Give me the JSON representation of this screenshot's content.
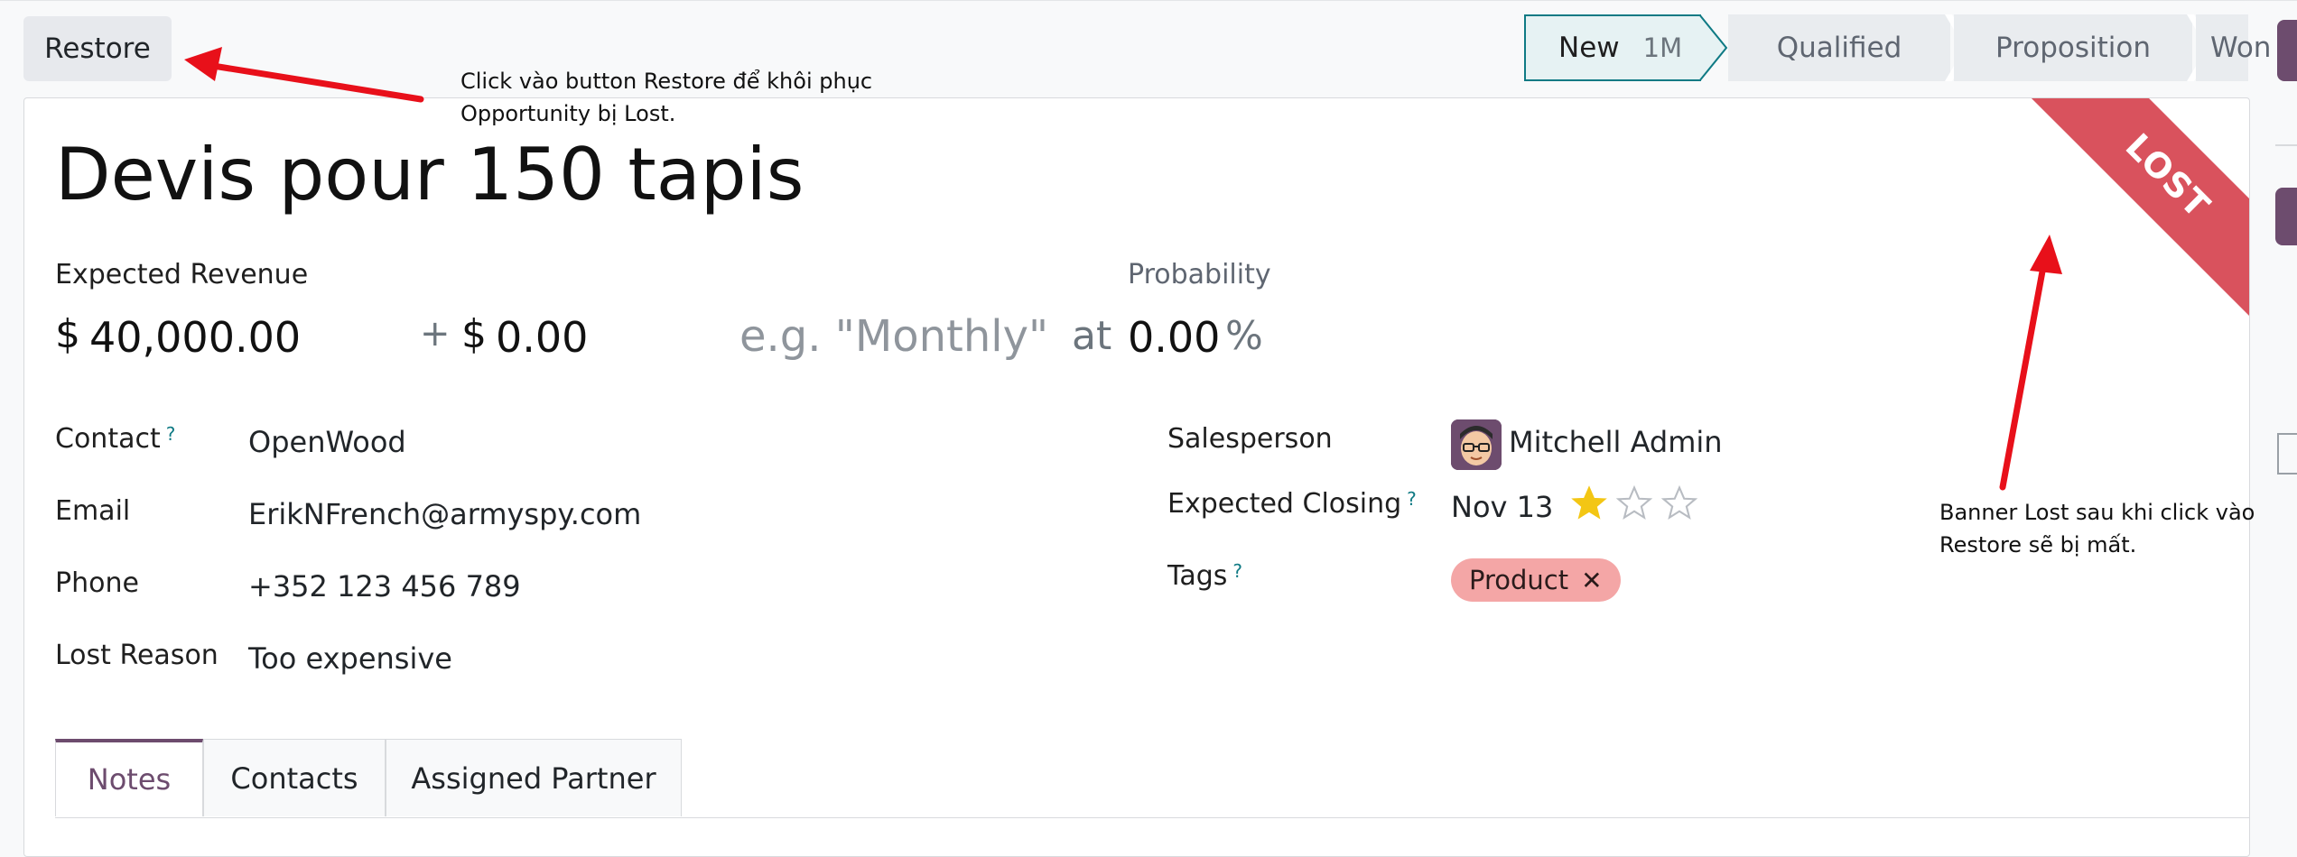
{
  "toolbar": {
    "restore_label": "Restore"
  },
  "statusbar": {
    "stages": [
      {
        "label": "New",
        "count": "1M",
        "active": true
      },
      {
        "label": "Qualified"
      },
      {
        "label": "Proposition"
      },
      {
        "label": "Won"
      }
    ]
  },
  "annotations": {
    "restore_note": "Click vào button Restore để khôi phục\nOpportunity bị Lost.",
    "banner_note": "Banner Lost sau khi click vào\nRestore sẽ bị mất."
  },
  "ribbon": {
    "text": "LOST",
    "color": "#d9525d"
  },
  "record": {
    "title": "Devis pour 150 tapis",
    "expected_revenue_label": "Expected Revenue",
    "currency": "$",
    "expected_revenue": "40,000.00",
    "plus": "+",
    "recurring_revenue": "0.00",
    "recurring_plan_placeholder": "e.g. \"Monthly\"",
    "at": "at",
    "probability_label": "Probability",
    "probability": "0.00",
    "percent": "%"
  },
  "left_fields": {
    "contact_label": "Contact",
    "contact": "OpenWood",
    "email_label": "Email",
    "email": "ErikNFrench@armyspy.com",
    "phone_label": "Phone",
    "phone": "+352 123 456 789",
    "lost_reason_label": "Lost Reason",
    "lost_reason": "Too expensive"
  },
  "right_fields": {
    "salesperson_label": "Salesperson",
    "salesperson": "Mitchell Admin",
    "expected_closing_label": "Expected Closing",
    "expected_closing": "Nov 13",
    "priority": 1,
    "priority_max": 3,
    "tags_label": "Tags",
    "tag": "Product"
  },
  "help_mark": "?",
  "tabs": [
    {
      "label": "Notes",
      "active": true
    },
    {
      "label": "Contacts"
    },
    {
      "label": "Assigned Partner"
    }
  ],
  "colors": {
    "accent": "#6d4c6e",
    "teal": "#0f7a84",
    "arrow": "#e8101a",
    "tag": "#f4a6a6"
  }
}
